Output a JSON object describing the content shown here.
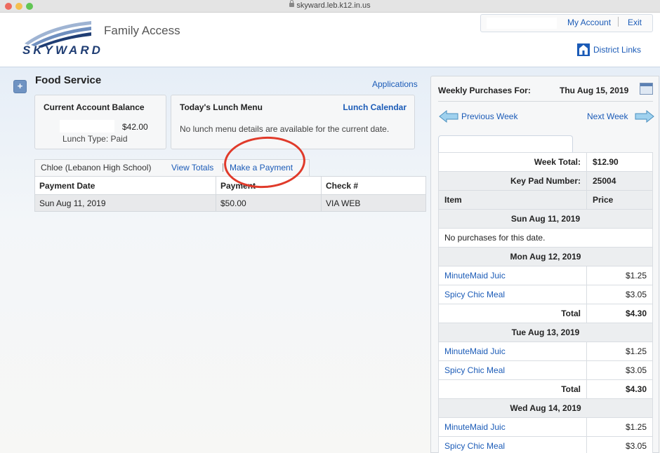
{
  "browser": {
    "url": "skyward.leb.k12.in.us"
  },
  "header": {
    "logo_text": "SKYWARD",
    "app_title": "Family Access",
    "my_account": "My Account",
    "exit": "Exit",
    "district_links": "District Links"
  },
  "food_service": {
    "title": "Food Service",
    "applications_link": "Applications",
    "balance_card": {
      "title": "Current Account Balance",
      "amount": "$42.00",
      "lunch_type": "Lunch Type:  Paid"
    },
    "menu_card": {
      "title": "Today's Lunch Menu",
      "calendar_link": "Lunch Calendar",
      "message": "No lunch menu details are available for the current date."
    },
    "student": {
      "name": "Chloe (Lebanon High School)",
      "view_totals": "View Totals",
      "make_payment": "Make a Payment"
    },
    "payments": {
      "headers": [
        "Payment Date",
        "Payment",
        "Check #"
      ],
      "rows": [
        [
          "Sun Aug 11, 2019",
          "$50.00",
          "VIA WEB"
        ]
      ]
    }
  },
  "weekly": {
    "label": "Weekly Purchases For:",
    "date": "Thu Aug 15, 2019",
    "prev_week": "Previous Week",
    "next_week": "Next Week",
    "week_total_label": "Week Total:",
    "week_total": "$12.90",
    "keypad_label": "Key Pad Number:",
    "keypad": "25004",
    "col_item": "Item",
    "col_price": "Price",
    "total_label": "Total",
    "days": [
      {
        "date": "Sun Aug 11, 2019",
        "none": "No purchases for this date."
      },
      {
        "date": "Mon Aug 12, 2019",
        "items": [
          [
            "MinuteMaid Juic",
            "$1.25"
          ],
          [
            "Spicy Chic Meal",
            "$3.05"
          ]
        ],
        "total": "$4.30"
      },
      {
        "date": "Tue Aug 13, 2019",
        "items": [
          [
            "MinuteMaid Juic",
            "$1.25"
          ],
          [
            "Spicy Chic Meal",
            "$3.05"
          ]
        ],
        "total": "$4.30"
      },
      {
        "date": "Wed Aug 14, 2019",
        "items": [
          [
            "MinuteMaid Juic",
            "$1.25"
          ],
          [
            "Spicy Chic Meal",
            "$3.05"
          ]
        ]
      }
    ]
  }
}
